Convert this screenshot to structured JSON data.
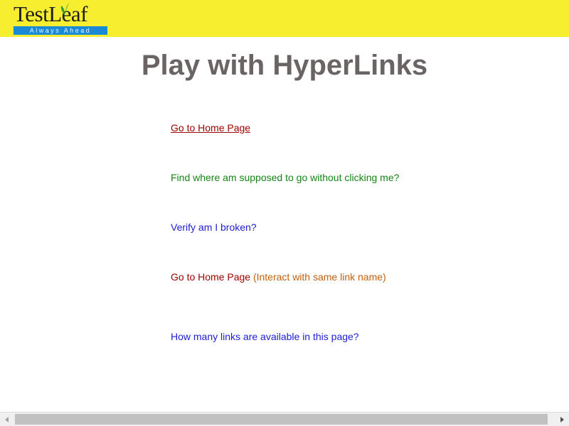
{
  "header": {
    "logo_text": "TestLeaf",
    "logo_tagline": "Always Ahead",
    "background_color": "#f6ee2e",
    "leaf_icon": "leaf-icon"
  },
  "page": {
    "title": "Play with HyperLinks"
  },
  "links": {
    "home": "Go to Home Page",
    "where_to_go": "Find where am supposed to go without clicking me?",
    "broken": "Verify am I broken?",
    "home_same_name": "Go to Home Page",
    "same_name_note": "(Interact with same link name)",
    "how_many": "How many links are available in this page?"
  },
  "colors": {
    "title": "#6b6464",
    "link_dark_red": "#a00000",
    "link_green": "#158415",
    "link_blue": "#1d1dd4",
    "note_orange": "#c26010"
  },
  "scrollbar": {
    "left_icon": "arrow-left-icon",
    "right_icon": "arrow-right-icon"
  }
}
